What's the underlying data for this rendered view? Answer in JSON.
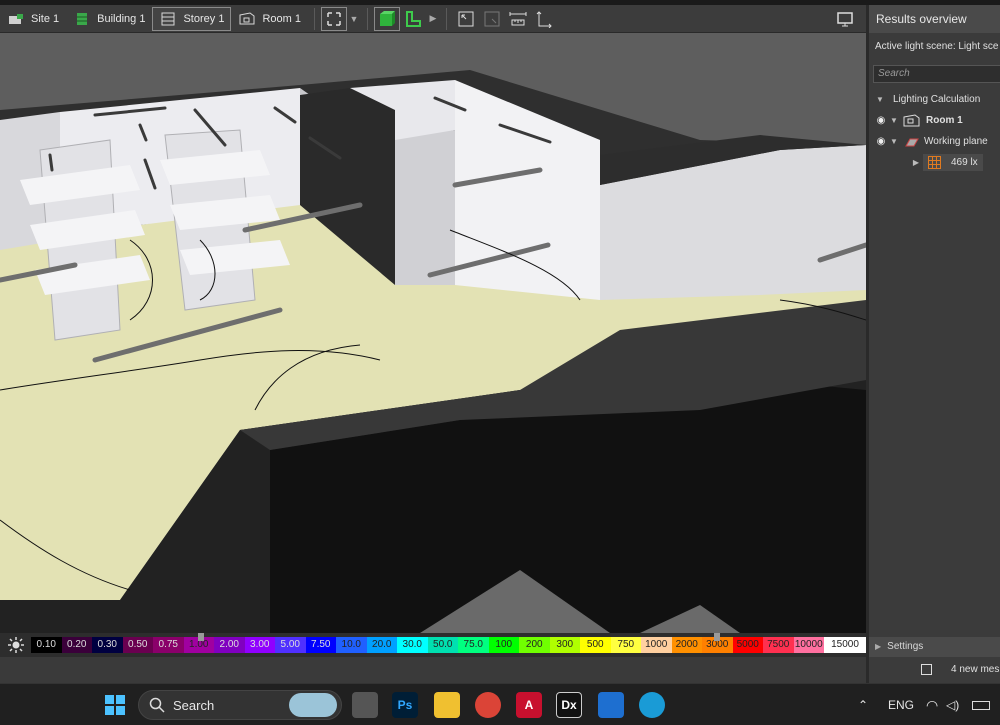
{
  "toolbar": {
    "breadcrumbs": [
      {
        "label": "Site 1",
        "icon": "site-icon"
      },
      {
        "label": "Building 1",
        "icon": "building-icon"
      },
      {
        "label": "Storey 1",
        "icon": "storey-icon"
      },
      {
        "label": "Room 1",
        "icon": "room-icon"
      }
    ],
    "active_crumb": "Storey 1"
  },
  "legend": {
    "values": [
      "0.10",
      "0.20",
      "0.30",
      "0.50",
      "0.75",
      "1.00",
      "2.00",
      "3.00",
      "5.00",
      "7.50",
      "10.0",
      "20.0",
      "30.0",
      "50.0",
      "75.0",
      "100",
      "200",
      "300",
      "500",
      "750",
      "1000",
      "2000",
      "3000",
      "5000",
      "7500",
      "10000",
      "15000"
    ],
    "colors": [
      "#000000",
      "#3a003a",
      "#000040",
      "#6a0050",
      "#8a006a",
      "#a000a0",
      "#8000c0",
      "#9000ff",
      "#5030ff",
      "#0000ff",
      "#2060ff",
      "#00a0ff",
      "#00ffff",
      "#00e0b0",
      "#00ff80",
      "#00ff00",
      "#70ff00",
      "#b0ff00",
      "#ffff00",
      "#ffff40",
      "#ffd0a0",
      "#ff9000",
      "#ff8000",
      "#ff0000",
      "#ff3050",
      "#ff70a0",
      "#ffffff"
    ],
    "text_colors": [
      "#dddddd",
      "#dddddd",
      "#dddddd",
      "#dddddd",
      "#dddddd",
      "#222222",
      "#dddddd",
      "#dddddd",
      "#dddddd",
      "#dddddd",
      "#222222",
      "#222222",
      "#222222",
      "#222222",
      "#222222",
      "#222222",
      "#222222",
      "#222222",
      "#222222",
      "#222222",
      "#222222",
      "#222222",
      "#222222",
      "#222222",
      "#222222",
      "#222222",
      "#222222"
    ]
  },
  "panel": {
    "title": "Results overview",
    "active_scene": "Active light scene: Light sce",
    "search_placeholder": "Search",
    "tree": {
      "group": "Lighting Calculation",
      "room": "Room 1",
      "plane": "Working plane",
      "result": "469 lx"
    },
    "settings": "Settings",
    "status": "4 new mes"
  },
  "taskbar": {
    "search_label": "Search",
    "lang": "ENG",
    "apps": [
      "windows-start-icon",
      "task-view-icon",
      "photoshop-icon",
      "file-explorer-icon",
      "chrome-icon",
      "autocad-icon",
      "dialux-icon",
      "installer-icon",
      "edge-icon"
    ],
    "photoshop_label": "Ps",
    "autocad_label": "A",
    "dialux_label": "Dx"
  }
}
